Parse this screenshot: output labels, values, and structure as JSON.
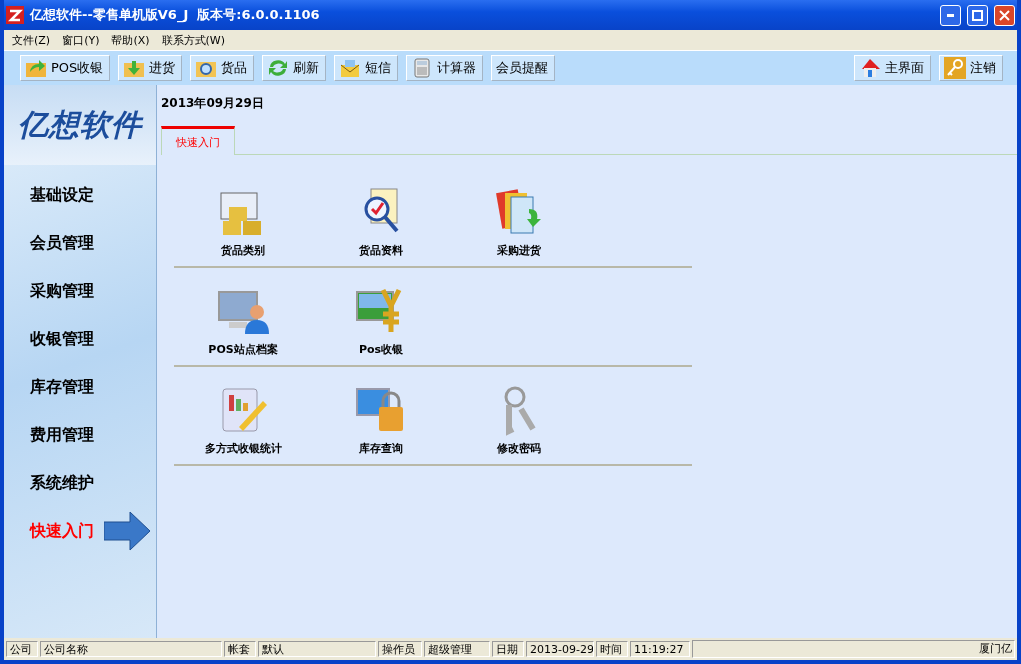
{
  "window": {
    "title": "亿想软件--零售单机版V6_J  版本号:6.0.0.1106"
  },
  "menu": [
    "文件(Z)",
    "窗口(Y)",
    "帮助(X)",
    "联系方式(W)"
  ],
  "toolbar_left": [
    "POS收银",
    "进货",
    "货品",
    "刷新",
    "短信",
    "计算器",
    "会员提醒"
  ],
  "toolbar_right": [
    "主界面",
    "注销"
  ],
  "sidebar": {
    "logo": "亿想软件",
    "items": [
      {
        "label": "基础设定",
        "selected": false
      },
      {
        "label": "会员管理",
        "selected": false
      },
      {
        "label": "采购管理",
        "selected": false
      },
      {
        "label": "收银管理",
        "selected": false
      },
      {
        "label": "库存管理",
        "selected": false
      },
      {
        "label": "费用管理",
        "selected": false
      },
      {
        "label": "系统维护",
        "selected": false
      },
      {
        "label": "快速入门",
        "selected": true
      }
    ]
  },
  "date": "2013年09月29日",
  "tabs": [
    {
      "label": "快速入门",
      "selected": true
    }
  ],
  "quick_groups": [
    {
      "items": [
        "货品类别",
        "货品资料",
        "采购进货"
      ]
    },
    {
      "items": [
        "POS站点档案",
        "Pos收银"
      ]
    },
    {
      "items": [
        "多方式收银统计",
        "库存查询",
        "修改密码"
      ]
    }
  ],
  "status_bar": [
    {
      "label": "公司",
      "value": "公司名称"
    },
    {
      "label": "帐套",
      "value": "默认"
    },
    {
      "label": "操作员",
      "value": "超级管理"
    },
    {
      "label": "日期",
      "value": "2013-09-29"
    },
    {
      "label": "时间",
      "value": "11:19:27"
    },
    {
      "value": "厦门亿"
    }
  ]
}
